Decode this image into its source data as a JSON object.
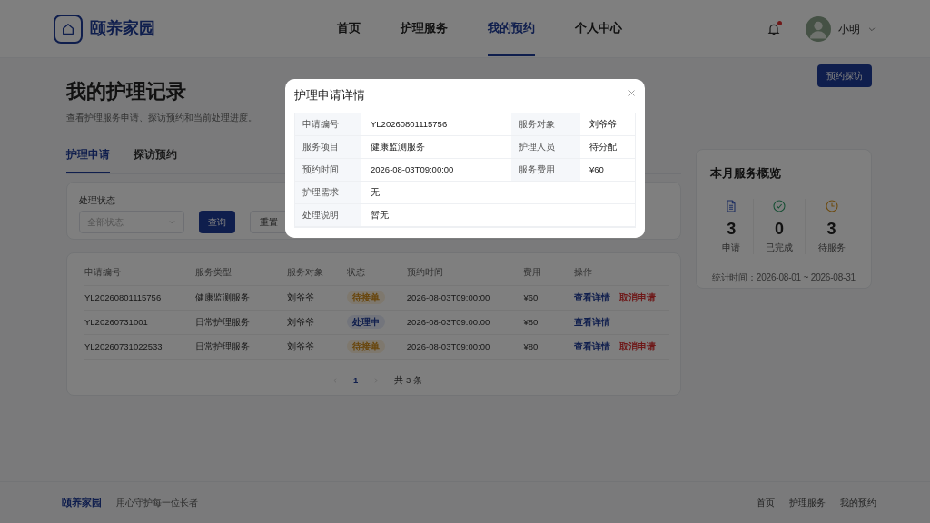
{
  "brand": {
    "name": "颐养家园"
  },
  "nav": [
    {
      "label": "首页",
      "selected": false
    },
    {
      "label": "护理服务",
      "selected": false
    },
    {
      "label": "我的预约",
      "selected": true
    },
    {
      "label": "个人中心",
      "selected": false
    }
  ],
  "header": {
    "notification_unread": true,
    "user": {
      "name": "小明"
    }
  },
  "page": {
    "title": "我的护理记录",
    "subtitle": "查看护理服务申请、探访预约和当前处理进度。",
    "action_button": "预约探访"
  },
  "tabs": [
    {
      "label": "护理申请",
      "selected": true
    },
    {
      "label": "探访预约",
      "selected": false
    }
  ],
  "filter": {
    "label": "处理状态",
    "select": {
      "placeholder": "全部状态"
    },
    "buttons": [
      {
        "label": "查询",
        "kind": "primary"
      },
      {
        "label": "重置",
        "kind": "secondary"
      }
    ]
  },
  "table": {
    "columns": [
      "申请编号",
      "服务类型",
      "服务对象",
      "状态",
      "预约时间",
      "费用",
      "操作"
    ],
    "rows": [
      {
        "id": "YL20260801115756",
        "type": "健康监测服务",
        "target": "刘爷爷",
        "status": {
          "text": "待接单",
          "kind": "pending"
        },
        "time": "2026-08-03T09:00:00",
        "fee": "¥60",
        "actions": [
          {
            "label": "查看详情",
            "kind": "view"
          },
          {
            "label": "取消申请",
            "kind": "cancel"
          }
        ]
      },
      {
        "id": "YL20260731001",
        "type": "日常护理服务",
        "target": "刘爷爷",
        "status": {
          "text": "处理中",
          "kind": "processing"
        },
        "time": "2026-08-03T09:00:00",
        "fee": "¥80",
        "actions": [
          {
            "label": "查看详情",
            "kind": "view"
          }
        ]
      },
      {
        "id": "YL20260731022533",
        "type": "日常护理服务",
        "target": "刘爷爷",
        "status": {
          "text": "待接单",
          "kind": "pending"
        },
        "time": "2026-08-03T09:00:00",
        "fee": "¥80",
        "actions": [
          {
            "label": "查看详情",
            "kind": "view"
          },
          {
            "label": "取消申请",
            "kind": "cancel"
          }
        ]
      }
    ]
  },
  "pagination": {
    "current": "1",
    "total": "共 3 条"
  },
  "summary": {
    "title": "本月服务概览",
    "stats": [
      {
        "kind": "document",
        "value": "3",
        "label": "申请"
      },
      {
        "kind": "done",
        "value": "0",
        "label": "已完成"
      },
      {
        "kind": "clock",
        "value": "3",
        "label": "待服务"
      }
    ],
    "period": "统计时间：2026-08-01 ~ 2026-08-31"
  },
  "modal": {
    "title": "护理申请详情",
    "rows": [
      [
        {
          "label": "申请编号",
          "value": "YL20260801115756"
        },
        {
          "label": "服务对象",
          "value": "刘爷爷"
        }
      ],
      [
        {
          "label": "服务项目",
          "value": "健康监测服务"
        },
        {
          "label": "护理人员",
          "value": "待分配"
        }
      ],
      [
        {
          "label": "预约时间",
          "value": "2026-08-03T09:00:00"
        },
        {
          "label": "服务费用",
          "value": "¥60"
        }
      ],
      [
        {
          "label": "护理需求",
          "value": "无"
        }
      ],
      [
        {
          "label": "处理说明",
          "value": "暂无"
        }
      ]
    ]
  },
  "footer": {
    "brand": "颐养家园",
    "tagline": "用心守护每一位长者",
    "links": [
      "首页",
      "护理服务",
      "我的预约"
    ]
  }
}
